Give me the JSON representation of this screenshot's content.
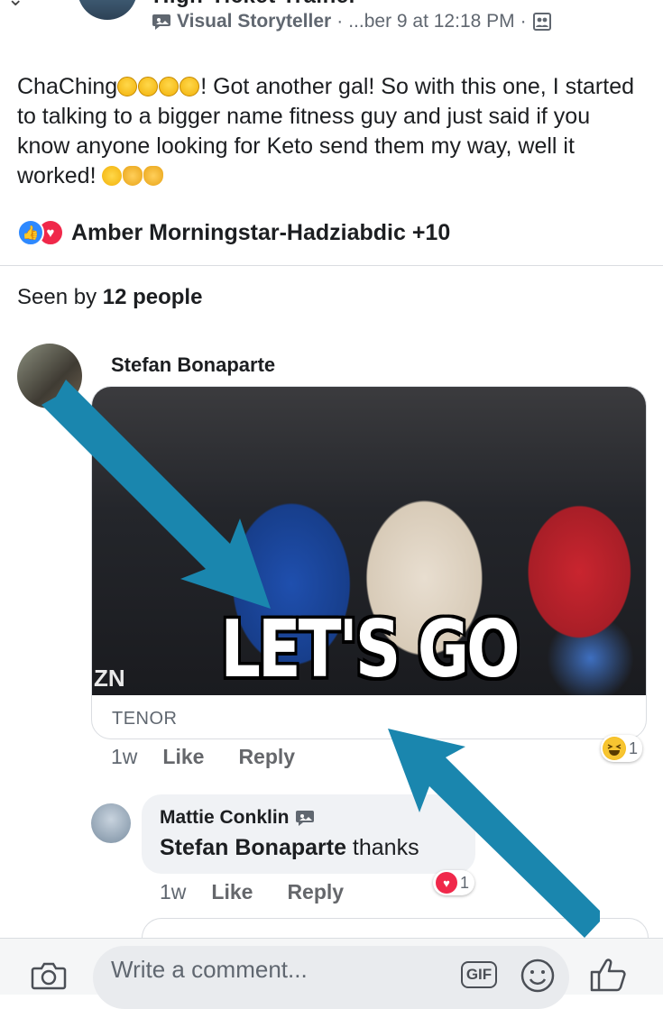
{
  "header": {
    "group_name": "High-Ticket Trainer",
    "author_badge": "Visual Storyteller",
    "separator": "·",
    "timestamp": "...ber 9 at 12:18 PM",
    "chevron": "⌄"
  },
  "post": {
    "text_before_emoji": "ChaChing",
    "text_main": "! Got another gal! So with this one, I started to talking to a bigger name fitness guy and just said if you know anyone looking for Keto send them my way, well it worked! ",
    "reactions_names": "Amber Morningstar-Hadziabdic +10",
    "seen_prefix": "Seen by ",
    "seen_count": "12 people"
  },
  "comments": [
    {
      "author": "Stefan Bonaparte",
      "gif_caption": "LET'S GO",
      "gif_watermark": "ZN",
      "gif_source": "TENOR",
      "time": "1w",
      "like_label": "Like",
      "reply_label": "Reply",
      "reaction_count": "1"
    },
    {
      "author": "Mattie Conklin",
      "mention": "Stefan Bonaparte",
      "text": " thanks",
      "time": "1w",
      "like_label": "Like",
      "reply_label": "Reply",
      "reaction_count": "1"
    }
  ],
  "composer": {
    "placeholder": "Write a comment...",
    "gif_label": "GIF"
  },
  "colors": {
    "like_blue": "#2e89ff",
    "love_red": "#f0284a",
    "annotation_arrow": "#1a86ae"
  },
  "icons": [
    "chevron-down-icon",
    "visual-storyteller-icon",
    "group-privacy-icon",
    "like-reaction-icon",
    "love-reaction-icon",
    "haha-reaction-icon",
    "camera-icon",
    "gif-icon",
    "emoji-icon",
    "thumbs-up-icon",
    "arrow-annotation"
  ]
}
